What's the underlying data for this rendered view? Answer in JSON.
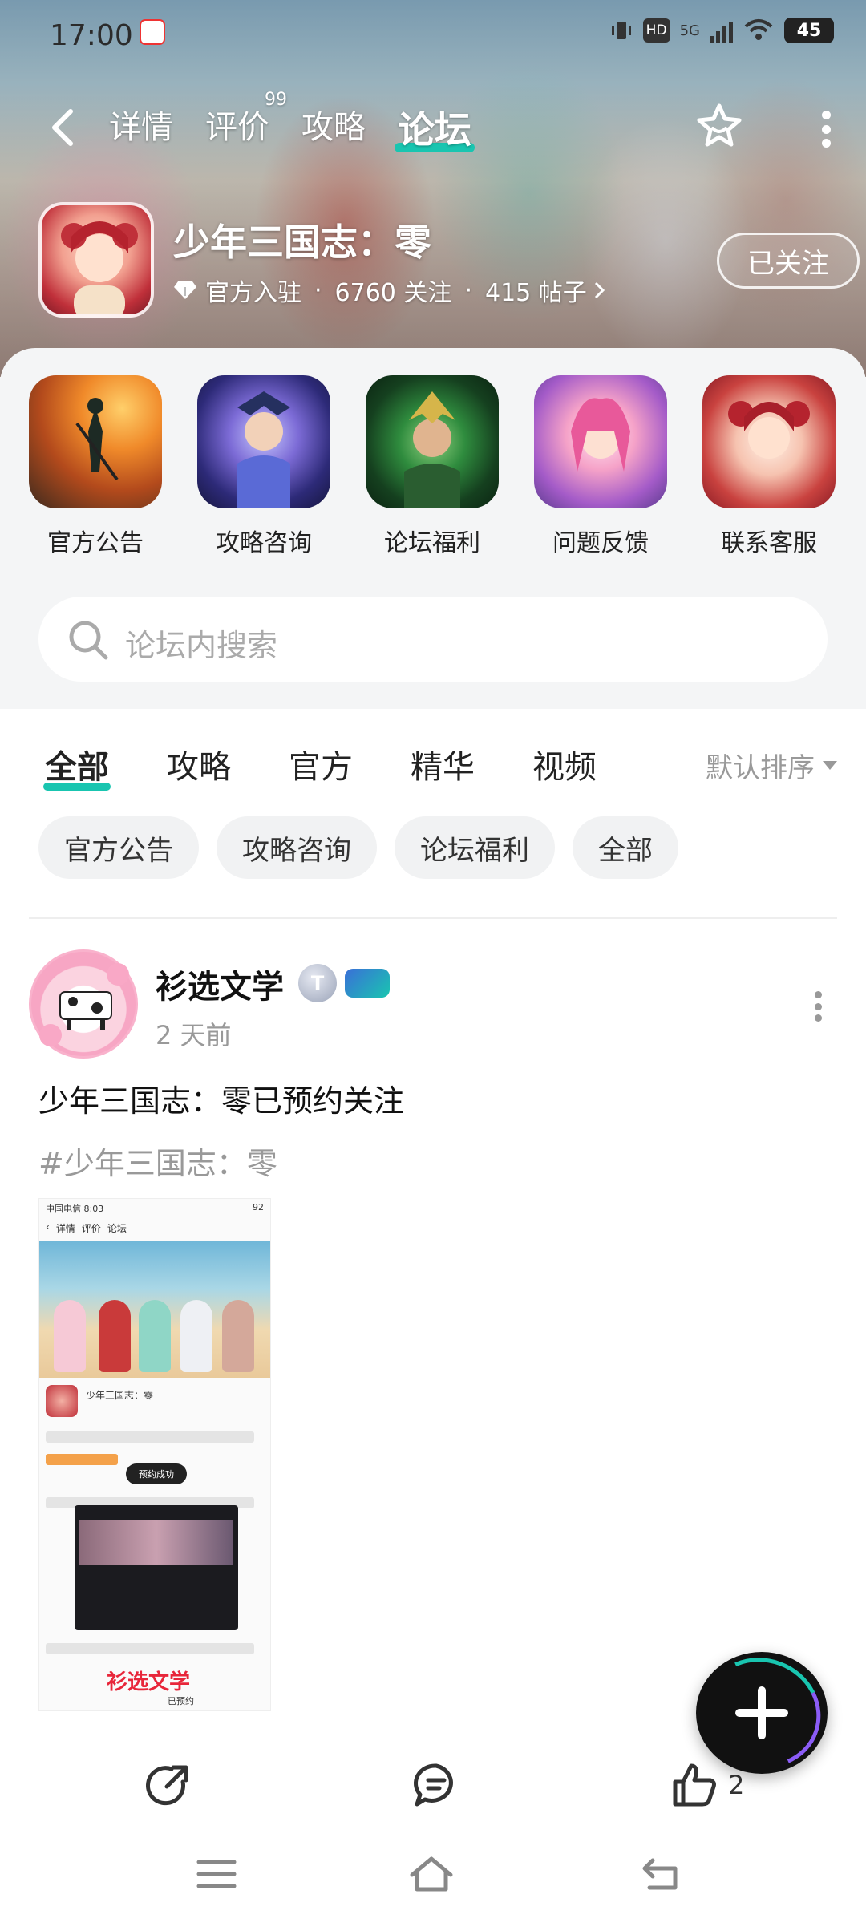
{
  "status": {
    "time": "17:00",
    "hd": "HD",
    "network": "5G",
    "battery": "45"
  },
  "nav": {
    "tabs": [
      {
        "label": "详情"
      },
      {
        "label": "评价",
        "sup": "99"
      },
      {
        "label": "攻略"
      },
      {
        "label": "论坛"
      }
    ],
    "active_tab": "论坛"
  },
  "game": {
    "name": "少年三国志：零",
    "official": "官方入驻",
    "followers": "6760 关注",
    "posts": "415 帖子",
    "follow_label": "已关注"
  },
  "shortcuts": [
    {
      "label": "官方公告",
      "icon": "official-notice"
    },
    {
      "label": "攻略咨询",
      "icon": "guide"
    },
    {
      "label": "论坛福利",
      "icon": "welfare"
    },
    {
      "label": "问题反馈",
      "icon": "feedback"
    },
    {
      "label": "联系客服",
      "icon": "customer-service"
    }
  ],
  "search": {
    "placeholder": "论坛内搜索"
  },
  "filter_tabs": [
    "全部",
    "攻略",
    "官方",
    "精华",
    "视频"
  ],
  "sort_label": "默认排序",
  "chips": [
    "官方公告",
    "攻略咨询",
    "论坛福利",
    "全部"
  ],
  "post": {
    "author": "衫选文学",
    "level": "T",
    "time": "2 天前",
    "title": "少年三国志：零已预约关注",
    "tag": "#少年三国志：零",
    "screenshot": {
      "carrier": "中国电信 8:03",
      "battery": "92",
      "nav": [
        "详情",
        "评价",
        "论坛"
      ],
      "game_name": "少年三国志：零",
      "toast": "预约成功",
      "watermark": "衫选文学",
      "status_text": "已预约"
    }
  },
  "actions": {
    "like_count": "2"
  },
  "colors": {
    "accent": "#19c5b0",
    "fab": "#111111"
  }
}
